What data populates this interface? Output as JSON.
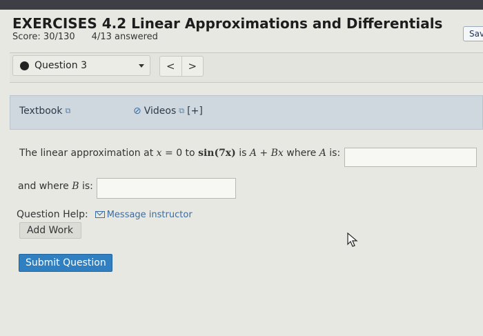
{
  "header": {
    "title": "EXERCISES 4.2 Linear Approximations and Differentials",
    "score": "Score: 30/130",
    "answered": "4/13 answered",
    "save_label": "Sav"
  },
  "question_nav": {
    "selected": "Question 3",
    "prev_label": "<",
    "next_label": ">"
  },
  "resources": {
    "textbook_label": "Textbook",
    "videos_label": "Videos",
    "videos_expand": "[+]"
  },
  "question": {
    "part_a_prefix": "The linear approximation at",
    "part_a_var": "x",
    "part_a_eq": "= 0 to",
    "part_a_func": "sin(7x)",
    "part_a_is": "is",
    "part_a_expr": "A + Bx",
    "part_a_where": "where",
    "part_a_varA": "A",
    "part_a_suffix": "is:",
    "part_b_prefix": "and where",
    "part_b_var": "B",
    "part_b_suffix": "is:",
    "answer_a_value": "",
    "answer_b_value": ""
  },
  "help": {
    "label": "Question Help:",
    "message_link": "Message instructor",
    "add_work": "Add Work"
  },
  "actions": {
    "submit_label": "Submit Question"
  }
}
